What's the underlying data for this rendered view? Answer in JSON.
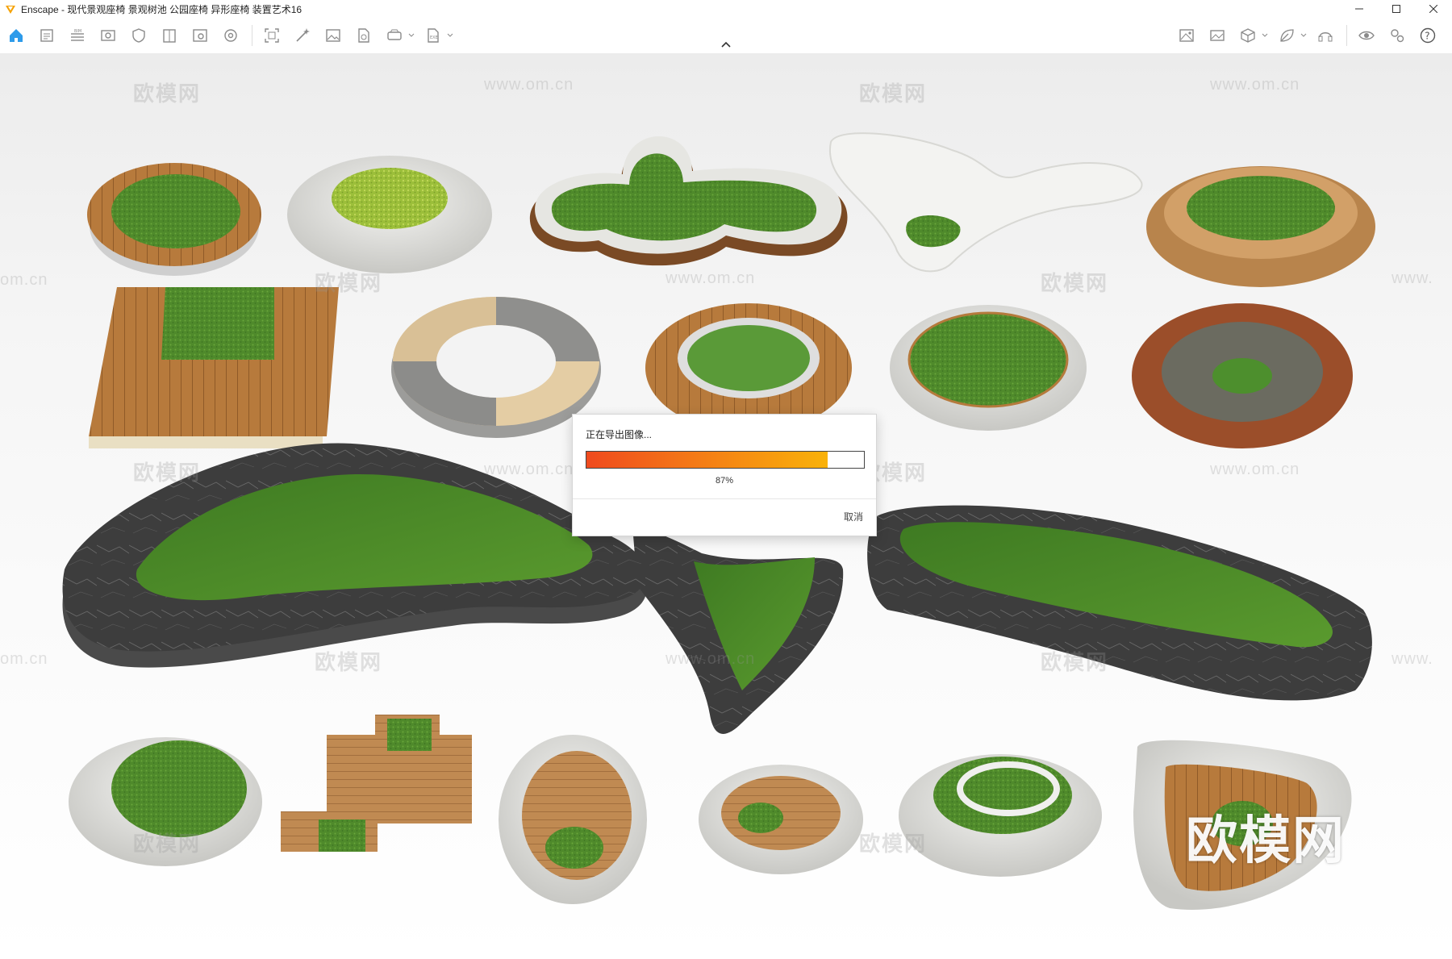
{
  "window": {
    "title": "Enscape - 现代景观座椅 景观树池 公园座椅 异形座椅 装置艺术16",
    "accent": "#f5a100"
  },
  "toolbar": {
    "left_icons": [
      "home-icon",
      "document-icon",
      "bim-icon",
      "eye-view-icon",
      "shield-icon",
      "book-icon",
      "info-icon",
      "settings-wheel-icon",
      "capture-icon",
      "magic-wand-icon",
      "image-icon",
      "file-export-icon",
      "vr-headset-icon",
      "export-icon"
    ],
    "right_icons": [
      "image-compare-icon",
      "gallery-icon",
      "cube-icon",
      "leaf-icon",
      "headset-icon",
      "visibility-icon",
      "settings-icon",
      "help-icon"
    ]
  },
  "watermarks": {
    "brand": "欧模网",
    "url": "www.om.cn",
    "url_cropped": "om.cn",
    "brand_cropped": "www."
  },
  "dialog": {
    "title": "正在导出图像...",
    "progress": 0.87,
    "progress_label": "87%",
    "cancel_label": "取消"
  }
}
